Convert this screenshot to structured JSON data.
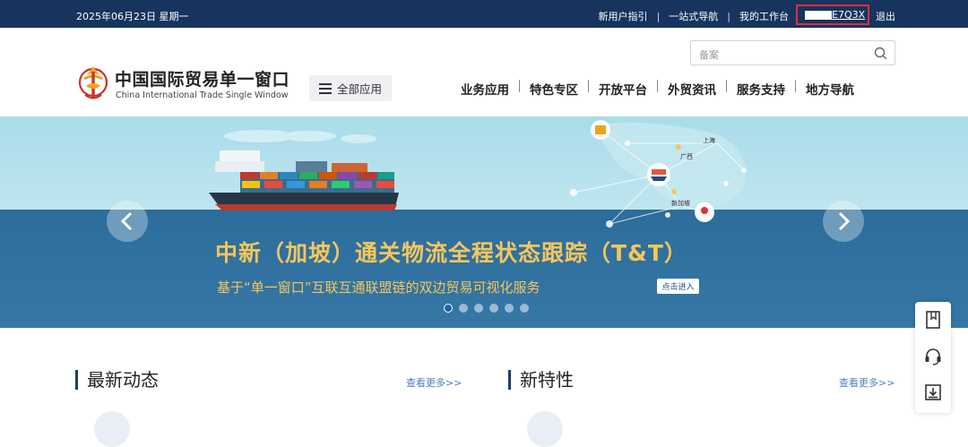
{
  "topbar": {
    "date": "2025年06月23日 星期一",
    "links": [
      "新用户指引",
      "一站式导航",
      "我的工作台"
    ],
    "user_id_visible": "E7Q3X",
    "logout": "退出"
  },
  "header": {
    "logo_cn": "中国国际贸易单一窗口",
    "logo_en": "China International Trade Single Window",
    "all_apps": "全部应用",
    "search_placeholder": "备案",
    "nav": [
      "业务应用",
      "特色专区",
      "开放平台",
      "外贸资讯",
      "服务支持",
      "地方导航"
    ]
  },
  "banner": {
    "title": "中新（加坡）通关物流全程状态跟踪（T&T）",
    "subtitle": "基于“单一窗口”互联互通联盟链的双边贸易可视化服务",
    "button": "点击进入",
    "map_labels": [
      "上海",
      "广西",
      "新加坡"
    ],
    "slides_count": 6,
    "active_slide": 1
  },
  "sections": {
    "news": {
      "title": "最新动态",
      "more": "查看更多>>"
    },
    "features": {
      "title": "新特性",
      "more": "查看更多>>"
    }
  },
  "floatbar": [
    "bookmark-icon",
    "headset-icon",
    "download-icon"
  ],
  "colors": {
    "topbar": "#16345e",
    "accent_yellow": "#f6c65b",
    "link_blue": "#4b7dc2",
    "highlight_red": "#e0303a"
  }
}
